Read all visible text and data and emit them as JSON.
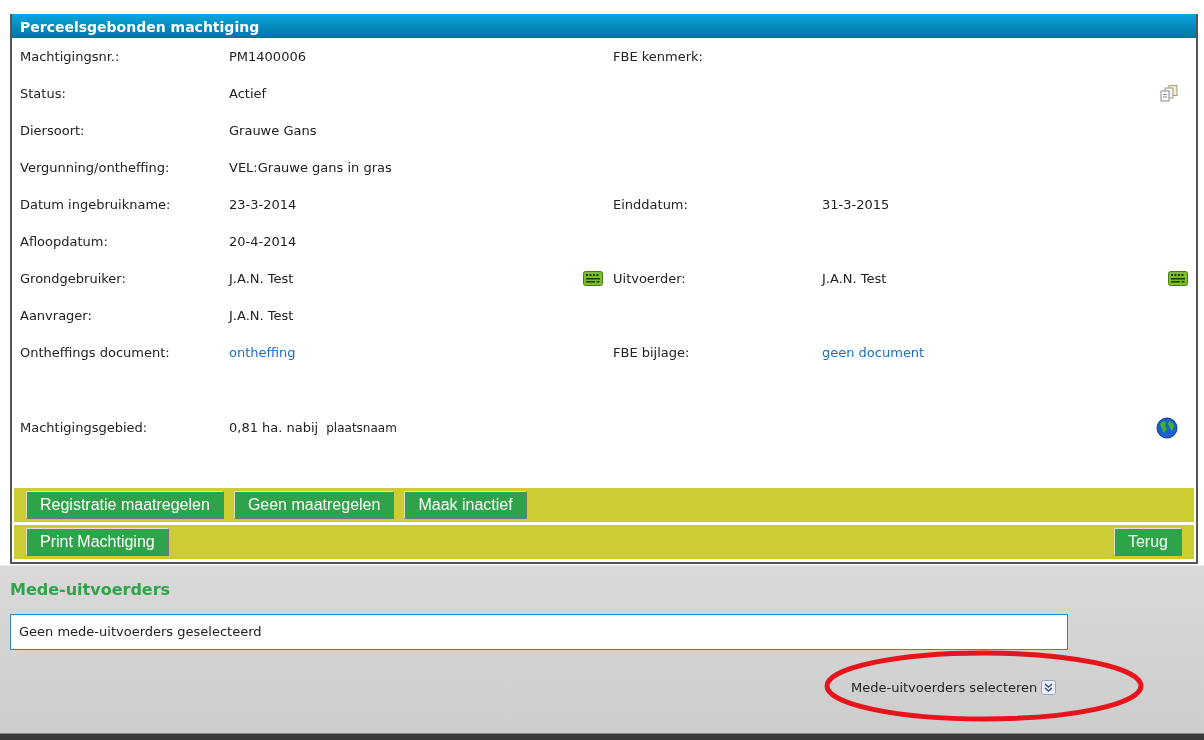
{
  "panel": {
    "title": "Perceelsgebonden machtiging"
  },
  "rows": [
    {
      "kind": "plain",
      "cells": [
        {
          "label": "Machtigingsnr.:",
          "value": "PM1400006",
          "kind": "text"
        },
        {
          "label": "FBE kenmerk:"
        }
      ]
    },
    {
      "kind": "status",
      "cells": [
        {
          "label": "Status:",
          "value": "Actief",
          "kind": "text"
        }
      ]
    },
    {
      "kind": "plain",
      "cells": [
        {
          "label": "Diersoort:",
          "value": "Grauwe Gans",
          "kind": "text"
        }
      ]
    },
    {
      "kind": "plain",
      "cells": [
        {
          "label": "Vergunning/ontheffing:",
          "value": "VEL:Grauwe gans in gras",
          "kind": "text"
        }
      ]
    },
    {
      "kind": "plain",
      "cells": [
        {
          "label": "Datum ingebruikname:",
          "value": "23-3-2014",
          "kind": "text"
        },
        {
          "label": "Einddatum:",
          "value": "31-3-2015",
          "kind": "text"
        }
      ]
    },
    {
      "kind": "plain",
      "cells": [
        {
          "label": "Afloopdatum:",
          "value": "20-4-2014",
          "kind": "text"
        }
      ]
    },
    {
      "kind": "plain",
      "cells": [
        {
          "label": "Grondgebruiker:",
          "value": "J.A.N. Test",
          "kind": "person"
        },
        {
          "label": "Uitvoerder:",
          "value": "J.A.N. Test",
          "kind": "person"
        }
      ]
    },
    {
      "kind": "plain",
      "cells": [
        {
          "label": "Aanvrager:",
          "value": "J.A.N. Test",
          "kind": "text"
        }
      ]
    },
    {
      "kind": "plain",
      "cells": [
        {
          "label": "Ontheffings document:",
          "value": "ontheffing",
          "kind": "link"
        },
        {
          "label": "FBE bijlage:",
          "value": "geen document",
          "kind": "link"
        }
      ]
    },
    {
      "kind": "area",
      "cells": [
        {
          "label": "Machtigingsgebied:",
          "value": "0,81 ha. nabij",
          "place": "plaatsnaam",
          "kind": "text"
        }
      ]
    }
  ],
  "button_bars": [
    {
      "left": [
        "Registratie maatregelen",
        "Geen maatregelen",
        "Maak inactief"
      ]
    },
    {
      "left": [
        "Print Machtiging"
      ],
      "right": [
        "Terug"
      ]
    }
  ],
  "co_executors": {
    "heading": "Mede-uitvoerders",
    "value": "Geen mede-uitvoerders geselecteerd",
    "select_label": "Mede-uitvoerders selecteren"
  }
}
